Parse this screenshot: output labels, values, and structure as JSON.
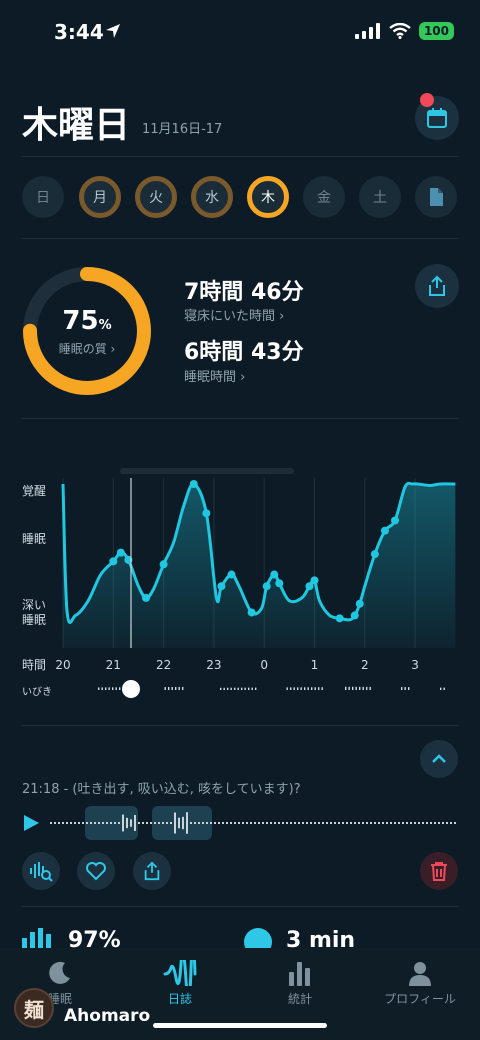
{
  "status": {
    "time": "3:44",
    "battery": "100"
  },
  "header": {
    "day": "木曜日",
    "date_range": "11月16日-17"
  },
  "week": [
    "日",
    "月",
    "火",
    "水",
    "木",
    "金",
    "土"
  ],
  "score": {
    "value": "75",
    "unit": "%",
    "label": "睡眠の質 ›",
    "fraction": 0.75
  },
  "stats": {
    "in_bed": "7時間 46分",
    "in_bed_label": "寝床にいた時間 ›",
    "asleep": "6時間 43分",
    "asleep_label": "睡眠時間 ›"
  },
  "chart_data": {
    "type": "area",
    "y_levels": [
      "覚醒",
      "睡眠",
      "深い睡眠"
    ],
    "x_label": "時間",
    "x_ticks": [
      "20",
      "21",
      "22",
      "23",
      "0",
      "1",
      "2",
      "3"
    ],
    "snore_label": "いびき",
    "color": "#1fc8e0",
    "series": [
      {
        "x": [
          20.0,
          20.08,
          20.25,
          20.5,
          20.75,
          21.0,
          21.15,
          21.3,
          21.5,
          21.65,
          21.8,
          22.0,
          22.2,
          22.4,
          22.6,
          22.85,
          23.05,
          23.15,
          23.35,
          23.5,
          23.75,
          23.95,
          24.05,
          24.2,
          24.3,
          24.5,
          24.75,
          24.9,
          25.0,
          25.1,
          25.3,
          25.5,
          25.7,
          25.8,
          25.9,
          26.0,
          26.2,
          26.4,
          26.6,
          26.8,
          26.95,
          27.05,
          27.3,
          27.5,
          27.8
        ],
        "y": [
          1.0,
          0.13,
          0.1,
          0.2,
          0.38,
          0.47,
          0.53,
          0.48,
          0.3,
          0.22,
          0.28,
          0.45,
          0.6,
          0.85,
          1.0,
          0.8,
          0.22,
          0.3,
          0.38,
          0.3,
          0.12,
          0.15,
          0.3,
          0.38,
          0.32,
          0.2,
          0.22,
          0.3,
          0.34,
          0.2,
          0.1,
          0.08,
          0.07,
          0.1,
          0.18,
          0.3,
          0.52,
          0.68,
          0.75,
          0.98,
          1.0,
          1.0,
          0.99,
          1.0,
          1.0
        ]
      }
    ]
  },
  "clip": {
    "text": "21:18 - (吐き出す, 吸い込む, 咳をしています)?"
  },
  "summary": {
    "left": "97%",
    "right": "3 min"
  },
  "nav": [
    {
      "label": "睡眠",
      "icon": "moon-icon",
      "active": false
    },
    {
      "label": "日誌",
      "icon": "waveform-icon",
      "active": true
    },
    {
      "label": "統計",
      "icon": "bar-chart-icon",
      "active": false
    },
    {
      "label": "プロフィール",
      "icon": "person-icon",
      "active": false
    }
  ],
  "user": {
    "name": "Ahomaro",
    "avatar_text": "麺"
  },
  "colors": {
    "accent": "#1fc8e0",
    "ring": "#f6a623",
    "danger": "#f04a5a",
    "background": "#0d1b26"
  }
}
